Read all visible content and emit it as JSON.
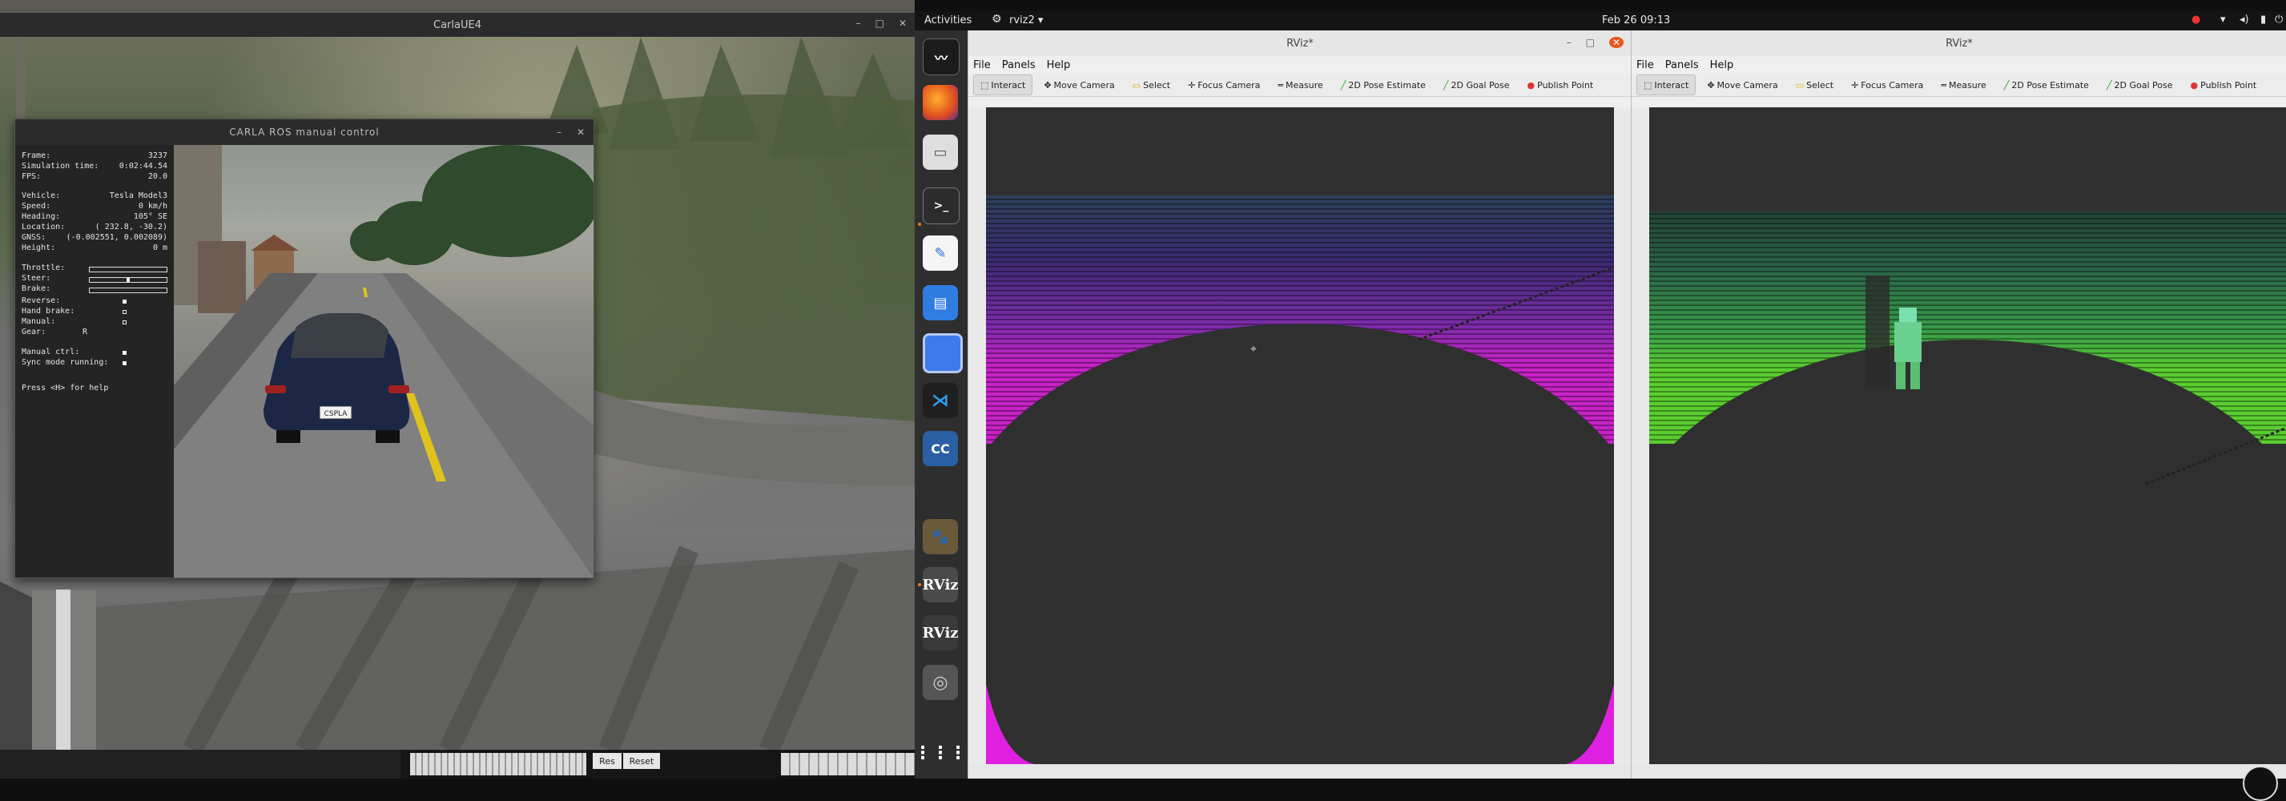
{
  "carla_window": {
    "title": "CarlaUE4",
    "overlay": {
      "title": "CARLA ROS manual control",
      "hud": {
        "frame_label": "Frame:",
        "frame_value": "3237",
        "sim_time_label": "Simulation time:",
        "sim_time_value": "0:02:44.54",
        "fps_label": "FPS:",
        "fps_value": "20.0",
        "vehicle_label": "Vehicle:",
        "vehicle_value": "Tesla Model3",
        "speed_label": "Speed:",
        "speed_value": "0 km/h",
        "heading_label": "Heading:",
        "heading_value": "105° SE",
        "location_label": "Location:",
        "location_value": "( 232.8, -30.2)",
        "gnss_label": "GNSS:",
        "gnss_value": "(-0.002551, 0.002089)",
        "height_label": "Height:",
        "height_value": "0 m",
        "throttle_label": "Throttle:",
        "throttle_value": 0.0,
        "steer_label": "Steer:",
        "steer_value": 0.5,
        "brake_label": "Brake:",
        "brake_value": 0.0,
        "reverse_label": "Reverse:",
        "hand_brake_label": "Hand brake:",
        "manual_label": "Manual:",
        "gear_label": "Gear:",
        "gear_value": "R",
        "manual_ctrl_label": "Manual ctrl:",
        "sync_label": "Sync mode running:",
        "help_text": "Press <H> for help"
      },
      "plate": "CSPLA"
    },
    "bottom_buttons": [
      "Res",
      "Reset"
    ]
  },
  "topbar": {
    "activities": "Activities",
    "app_menu": "rviz2 ▾",
    "datetime": "Feb 26  09:13"
  },
  "dock": {
    "icons": [
      "activity-monitor-icon",
      "firefox-icon",
      "files-icon",
      "terminal-icon",
      "text-editor-icon",
      "document-viewer-icon",
      "screenshot-icon",
      "vscode-icon",
      "cc-icon",
      "gimp-icon",
      "rviz-icon",
      "rviz-icon",
      "disk-icon",
      "app-grid-icon"
    ],
    "rviz_label": "RViz"
  },
  "rviz_left": {
    "title": "RViz*",
    "menu": [
      "File",
      "Panels",
      "Help"
    ],
    "tools": [
      "Interact",
      "Move Camera",
      "Select",
      "Focus Camera",
      "Measure",
      "2D Pose Estimate",
      "2D Goal Pose",
      "Publish Point"
    ],
    "point_color": "#e020e0"
  },
  "rviz_right": {
    "title": "RViz*",
    "menu": [
      "File",
      "Panels",
      "Help"
    ],
    "tools": [
      "Interact",
      "Move Camera",
      "Select",
      "Focus Camera",
      "Measure",
      "2D Pose Estimate",
      "2D Goal Pose",
      "Publish Point"
    ],
    "point_color": "#5fe030"
  }
}
